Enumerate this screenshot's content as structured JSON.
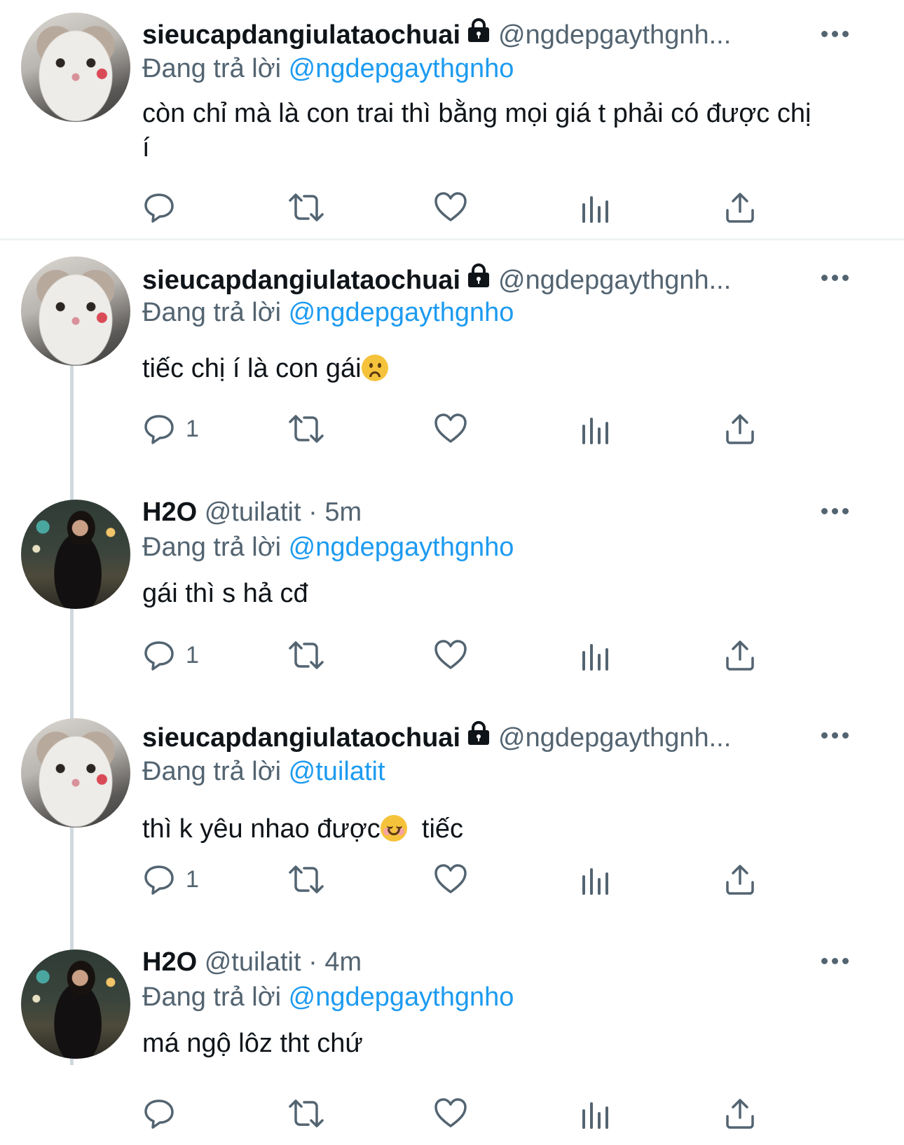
{
  "tweets": [
    {
      "name": "sieucapdangiulataochuai",
      "handle": "@ngdepgaythgnh...",
      "protected": true,
      "meta": "",
      "replying_label": "Đang trả lời",
      "replying_to": "@ngdepgaythgnho",
      "text_a": "còn chỉ mà là con trai thì bằng mọi giá t phải có được chị í",
      "text_b": "",
      "emoji": "",
      "reply_count": ""
    },
    {
      "name": "sieucapdangiulataochuai",
      "handle": "@ngdepgaythgnh...",
      "protected": true,
      "meta": "",
      "replying_label": "Đang trả lời",
      "replying_to": "@ngdepgaythgnho",
      "text_a": "tiếc chị í là con gái",
      "text_b": "",
      "emoji": "frowning-face",
      "reply_count": "1"
    },
    {
      "name": "H2O",
      "handle": "@tuilatit",
      "protected": false,
      "meta": "5m",
      "replying_label": "Đang trả lời",
      "replying_to": "@ngdepgaythgnho",
      "text_a": "gái thì s hả cđ",
      "text_b": "",
      "emoji": "",
      "reply_count": "1"
    },
    {
      "name": "sieucapdangiulataochuai",
      "handle": "@ngdepgaythgnh...",
      "protected": true,
      "meta": "",
      "replying_label": "Đang trả lời",
      "replying_to": "@tuilatit",
      "text_a": "thì k yêu nhao được",
      "text_b": "  tiếc",
      "emoji": "smiling-face",
      "reply_count": "1"
    },
    {
      "name": "H2O",
      "handle": "@tuilatit",
      "protected": false,
      "meta": "4m",
      "replying_label": "Đang trả lời",
      "replying_to": "@ngdepgaythgnho",
      "text_a": "má ngộ lôz tht chứ",
      "text_b": "",
      "emoji": "",
      "reply_count": ""
    }
  ],
  "separator": "·",
  "colors": {
    "text": "#0f1419",
    "secondary": "#536471",
    "link": "#1d9bf0",
    "thread_line": "#cfd9de",
    "divider": "#eff3f4"
  },
  "icons": [
    "lock-icon",
    "more-icon",
    "reply-icon",
    "retweet-icon",
    "like-icon",
    "analytics-icon",
    "share-icon"
  ]
}
